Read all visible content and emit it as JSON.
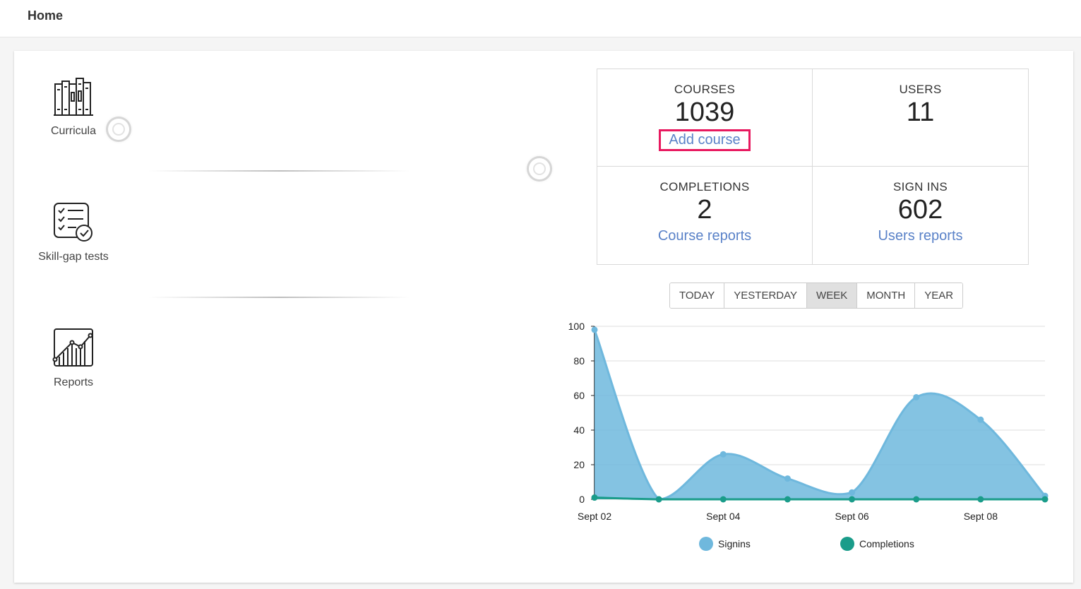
{
  "header": {
    "title": "Home"
  },
  "tiles": [
    {
      "label": "Curricula",
      "icon": "books-icon"
    },
    {
      "label": "Skill-gap tests",
      "icon": "checklist-icon"
    },
    {
      "label": "Reports",
      "icon": "line-chart-icon"
    }
  ],
  "stats": {
    "courses": {
      "label": "COURSES",
      "value": "1039",
      "link": "Add course"
    },
    "users": {
      "label": "USERS",
      "value": "11"
    },
    "completions": {
      "label": "COMPLETIONS",
      "value": "2",
      "link": "Course reports"
    },
    "signins": {
      "label": "SIGN INS",
      "value": "602",
      "link": "Users reports"
    }
  },
  "periods": [
    {
      "label": "TODAY",
      "active": false
    },
    {
      "label": "YESTERDAY",
      "active": false
    },
    {
      "label": "WEEK",
      "active": true
    },
    {
      "label": "MONTH",
      "active": false
    },
    {
      "label": "YEAR",
      "active": false
    }
  ],
  "colors": {
    "signins": "#6fb8dd",
    "completions": "#1a9c8a",
    "highlight": "#e8195f",
    "link": "#5a82c8"
  },
  "chart_data": {
    "type": "area",
    "x": [
      "Sept 02",
      "Sept 03",
      "Sept 04",
      "Sept 05",
      "Sept 06",
      "Sept 07",
      "Sept 08",
      "Sept 09"
    ],
    "xtick_labels": [
      "Sept 02",
      "Sept 04",
      "Sept 06",
      "Sept 08"
    ],
    "yticks": [
      0,
      20,
      40,
      60,
      80,
      100
    ],
    "ylim": [
      0,
      100
    ],
    "grid": true,
    "legend_position": "bottom",
    "series": [
      {
        "name": "Signins",
        "values": [
          98,
          0,
          26,
          12,
          4,
          59,
          46,
          2
        ]
      },
      {
        "name": "Completions",
        "values": [
          1,
          0,
          0,
          0,
          0,
          0,
          0,
          0
        ]
      }
    ]
  }
}
